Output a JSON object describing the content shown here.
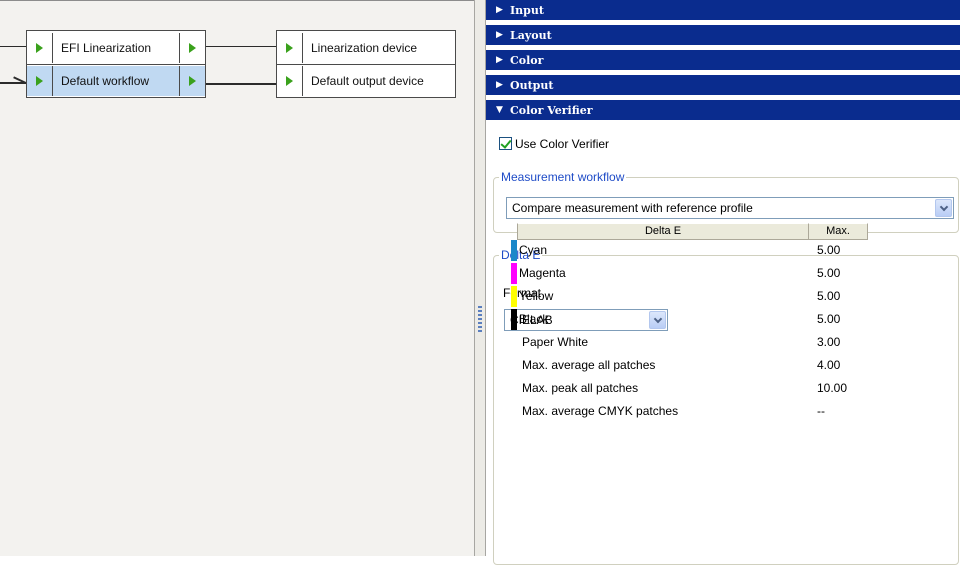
{
  "workflow_canvas": {
    "nodes": [
      {
        "label": "EFI Linearization",
        "row": "top"
      },
      {
        "label": "Default workflow",
        "row": "bottom",
        "selected": true
      },
      {
        "label": "Linearization device",
        "row": "top"
      },
      {
        "label": "Default output device",
        "row": "bottom"
      }
    ]
  },
  "accordion": {
    "sections": [
      {
        "label": "Input",
        "expanded": false
      },
      {
        "label": "Layout",
        "expanded": false
      },
      {
        "label": "Color",
        "expanded": false
      },
      {
        "label": "Output",
        "expanded": false
      },
      {
        "label": "Color Verifier",
        "expanded": true
      }
    ]
  },
  "color_verifier": {
    "use_checkbox": {
      "label": "Use Color Verifier",
      "checked": true
    },
    "measurement_workflow": {
      "title": "Measurement workflow",
      "selected": "Compare measurement with reference profile"
    },
    "delta_e": {
      "title": "Delta E",
      "format_label": "Format",
      "format_selected": "CIELAB",
      "table": {
        "columns": [
          "Delta E",
          "Max."
        ],
        "rows": [
          {
            "name": "Cyan",
            "max": "5.00",
            "swatch": "#1b88c9"
          },
          {
            "name": "Magenta",
            "max": "5.00",
            "swatch": "#ff00ff"
          },
          {
            "name": "Yellow",
            "max": "5.00",
            "swatch": "#ffff00"
          },
          {
            "name": "Black",
            "max": "5.00",
            "swatch": "#000000"
          },
          {
            "name": "Paper White",
            "max": "3.00",
            "swatch": ""
          },
          {
            "name": "Max. average all patches",
            "max": "4.00",
            "swatch": ""
          },
          {
            "name": "Max. peak all patches",
            "max": "10.00",
            "swatch": ""
          },
          {
            "name": "Max. average CMYK patches",
            "max": "--",
            "swatch": ""
          }
        ]
      }
    }
  },
  "colors": {
    "header_blue": "#0a2c8e",
    "selected_row": "#c0d9f2",
    "port_green": "#3aa11c",
    "group_title": "#1f4cc7"
  }
}
